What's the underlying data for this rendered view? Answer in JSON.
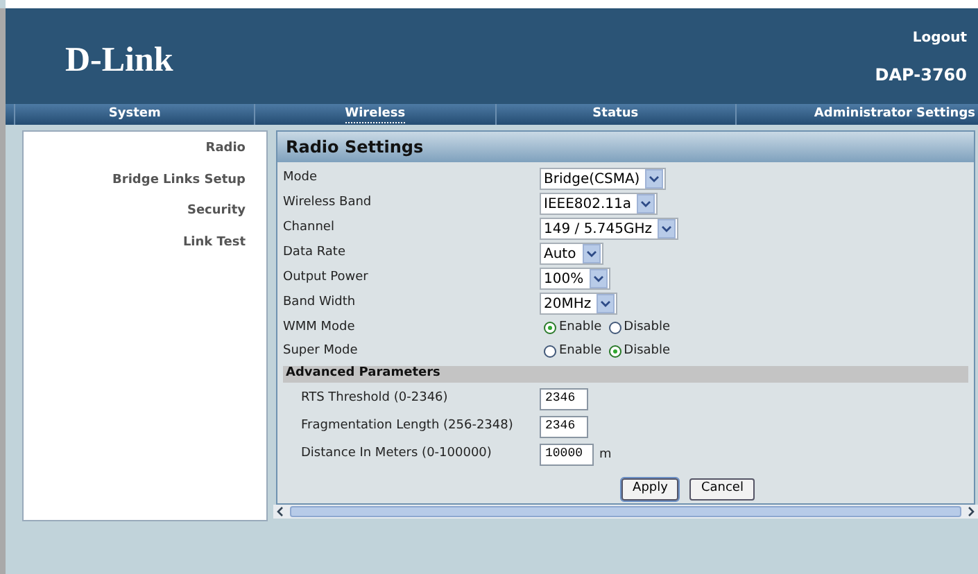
{
  "header": {
    "logo": "D-Link",
    "logout": "Logout",
    "model": "DAP-3760"
  },
  "tabs": [
    {
      "label": "System",
      "selected": false
    },
    {
      "label": "Wireless",
      "selected": true
    },
    {
      "label": "Status",
      "selected": false
    },
    {
      "label": "Administrator Settings",
      "selected": false
    }
  ],
  "sidebar": {
    "items": [
      "Radio",
      "Bridge Links Setup",
      "Security",
      "Link Test"
    ]
  },
  "panel": {
    "title": "Radio Settings",
    "rows": [
      {
        "kind": "select",
        "label": "Mode",
        "value": "Bridge(CSMA)"
      },
      {
        "kind": "select",
        "label": "Wireless Band",
        "value": "IEEE802.11a"
      },
      {
        "kind": "select",
        "label": "Channel",
        "value": "149 / 5.745GHz"
      },
      {
        "kind": "select",
        "label": "Data Rate",
        "value": "Auto"
      },
      {
        "kind": "select",
        "label": "Output Power",
        "value": "100%"
      },
      {
        "kind": "select",
        "label": "Band Width",
        "value": "20MHz"
      },
      {
        "kind": "radio",
        "label": "WMM Mode",
        "options": [
          {
            "label": "Enable",
            "selected": true
          },
          {
            "label": "Disable",
            "selected": false
          }
        ]
      },
      {
        "kind": "radio",
        "label": "Super Mode",
        "options": [
          {
            "label": "Enable",
            "selected": false
          },
          {
            "label": "Disable",
            "selected": true
          }
        ]
      },
      {
        "kind": "section",
        "label": "Advanced Parameters"
      },
      {
        "kind": "input",
        "label": "RTS Threshold (0-2346)",
        "value": "2346"
      },
      {
        "kind": "input",
        "label": "Fragmentation Length (256-2348)",
        "value": "2346"
      },
      {
        "kind": "input",
        "label": "Distance In Meters (0-100000)",
        "value": "10000",
        "unit": "m"
      }
    ],
    "buttons": [
      "Apply",
      "Cancel"
    ]
  }
}
